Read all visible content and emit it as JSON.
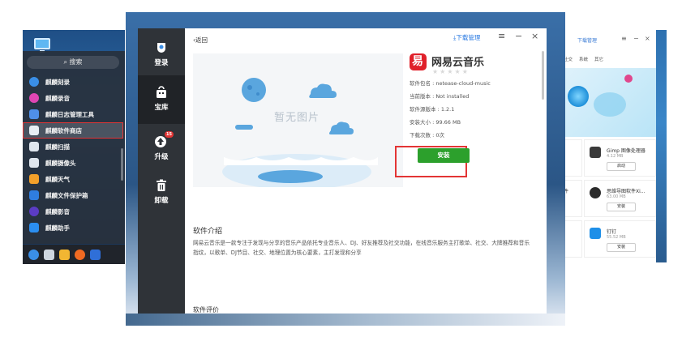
{
  "left_menu": {
    "search_label": "搜索",
    "items": [
      {
        "label": "麒麟刻录",
        "color": "#3a8ee6"
      },
      {
        "label": "麒麟录音",
        "color": "#e046b4"
      },
      {
        "label": "麒麟日志管理工具",
        "color": "#4f8fe8"
      },
      {
        "label": "麒麟软件商店",
        "color": "#e8eef4"
      },
      {
        "label": "麒麟扫描",
        "color": "#dfe6ee"
      },
      {
        "label": "麒麟摄像头",
        "color": "#dfe6ee"
      },
      {
        "label": "麒麟天气",
        "color": "#f2a02a"
      },
      {
        "label": "麒麟文件保护箱",
        "color": "#2f7de0"
      },
      {
        "label": "麒麟影音",
        "color": "#5b3cc4"
      },
      {
        "label": "麒麟助手",
        "color": "#2b8ef0"
      }
    ]
  },
  "background_window": {
    "download_manager": "下载管理",
    "tabs": [
      "社交",
      "系统",
      "其它"
    ],
    "side_label": "件",
    "cards": [
      {
        "name": "Gimp 图像处理器",
        "size": "4.12 MB",
        "button": "启动",
        "color": "#3a3a3a"
      },
      {
        "name": "思维导图软件Xi...",
        "size": "63.00 MB",
        "button": "安装",
        "color": "#2b2b2b"
      },
      {
        "name": "钉钉",
        "size": "55.52 MB",
        "button": "安装",
        "color": "#1e8fe8"
      }
    ]
  },
  "main_window": {
    "sidebar": [
      {
        "label": "登录",
        "icon": "user-icon"
      },
      {
        "label": "宝库",
        "icon": "store-icon"
      },
      {
        "label": "升级",
        "icon": "upgrade-icon",
        "badge": "15"
      },
      {
        "label": "卸载",
        "icon": "trash-icon"
      }
    ],
    "back_label": "返回",
    "download_manager": "下载管理",
    "window_controls": [
      "≡",
      "−",
      "×"
    ],
    "placeholder_text": "暂无图片",
    "app": {
      "logo_glyph": "易",
      "name": "网易云音乐",
      "stars": "★★★★★",
      "package": "软件包名 : netease-cloud-music",
      "current_version": "当前版本 : Not installed",
      "source_version": "软件源版本 : 1.2.1",
      "install_size": "安装大小 : 99.66 MB",
      "downloads": "下载次数 : 0次",
      "install_button": "安装"
    },
    "intro_title": "软件介绍",
    "intro_text": "网易云音乐是一款专注于发现与分享的音乐产品依托专业音乐人、DJ、好友推荐及社交功能，在线音乐服务主打歌单、社交、大牌推荐和音乐指纹，以歌单、DJ节目、社交、地理位置为核心要素，主打发现和分享",
    "bottom_title": "软件评价",
    "accent_green": "#2ca02c",
    "highlight_red": "#e33535"
  }
}
